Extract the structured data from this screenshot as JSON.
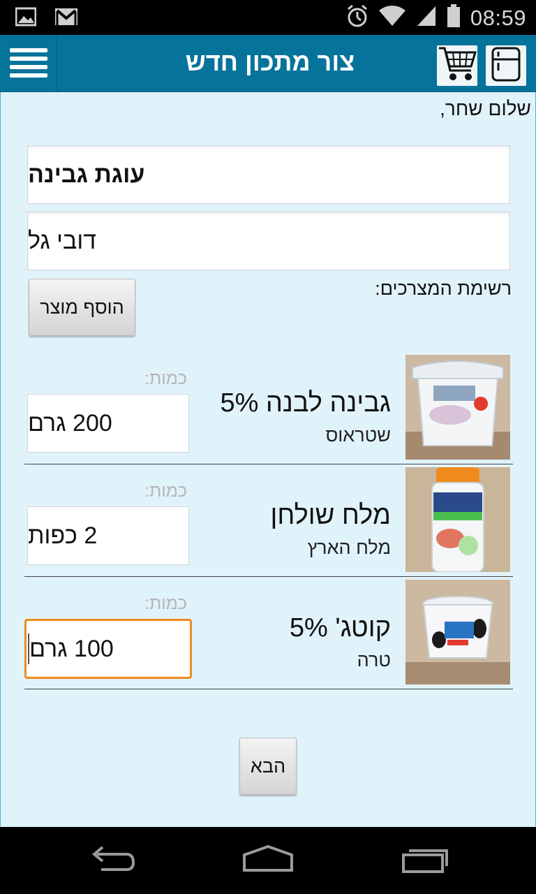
{
  "status_bar": {
    "time": "08:59",
    "icons": [
      "gallery-icon",
      "gmail-icon",
      "alarm-icon",
      "wifi-icon",
      "signal-icon",
      "battery-icon"
    ]
  },
  "app_bar": {
    "title": "צור מתכון חדש",
    "menu_icon": "hamburger-menu-icon",
    "cart_icon": "shopping-cart-icon",
    "fridge_icon": "fridge-icon",
    "color": "#06739b"
  },
  "form": {
    "greeting": "שלום שחר,",
    "recipe_name": "עוגת גבינה",
    "author": "דובי גל",
    "ingredients_label": "רשימת המצרכים:",
    "add_product_label": "הוסף מוצר"
  },
  "ingredients": [
    {
      "name": "גבינה לבנה 5%",
      "brand": "שטראוס",
      "qty_label": "כמות:",
      "qty_value": "200 גרם",
      "image": "white-cheese-tub"
    },
    {
      "name": "מלח שולחן",
      "brand": "מלח הארץ",
      "qty_label": "כמות:",
      "qty_value": "2 כפות",
      "image": "salt-shaker"
    },
    {
      "name": "קוטג' 5%",
      "brand": "טרה",
      "qty_label": "כמות:",
      "qty_value": "100 גרם",
      "image": "cottage-cheese-cup",
      "focused": true
    }
  ],
  "next_button": "הבא",
  "nav_bar": {
    "icons": [
      "back-icon",
      "home-icon",
      "recent-apps-icon"
    ]
  },
  "colors": {
    "content_bg": "#e1f3fa",
    "focus": "#f08a1c"
  }
}
